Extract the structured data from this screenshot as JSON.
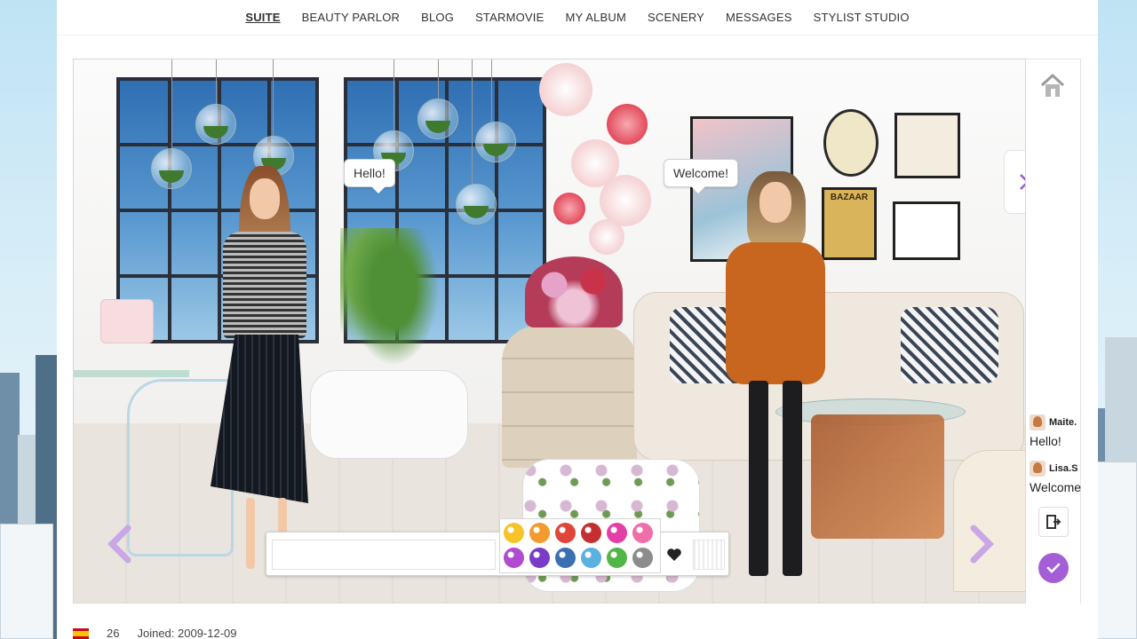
{
  "nav": {
    "tabs": [
      "SUITE",
      "BEAUTY PARLOR",
      "BLOG",
      "STARMOVIE",
      "MY ALBUM",
      "SCENERY",
      "MESSAGES",
      "STYLIST STUDIO"
    ],
    "active": "SUITE"
  },
  "scene": {
    "bubble_left": "Hello!",
    "bubble_right": "Welcome!",
    "frame_label": "BAZAAR"
  },
  "chat_input": {
    "value": "",
    "placeholder": ""
  },
  "emoji_colors": [
    "#f6c428",
    "#f39a2c",
    "#e0453a",
    "#c62f2f",
    "#e43fa7",
    "#f06fa8",
    "#b04ad0",
    "#7a3cc8",
    "#3a6fb2",
    "#5ab0e0",
    "#52b548",
    "#8c8c8c"
  ],
  "sidebar": {
    "chat": [
      {
        "name": "Maite.",
        "message": "Hello!"
      },
      {
        "name": "Lisa.S",
        "message": "Welcome"
      }
    ]
  },
  "footer": {
    "level": "26",
    "joined": "Joined: 2009-12-09"
  },
  "colors": {
    "accent": "#a55fd6",
    "arrow": "#c9a6e6"
  }
}
